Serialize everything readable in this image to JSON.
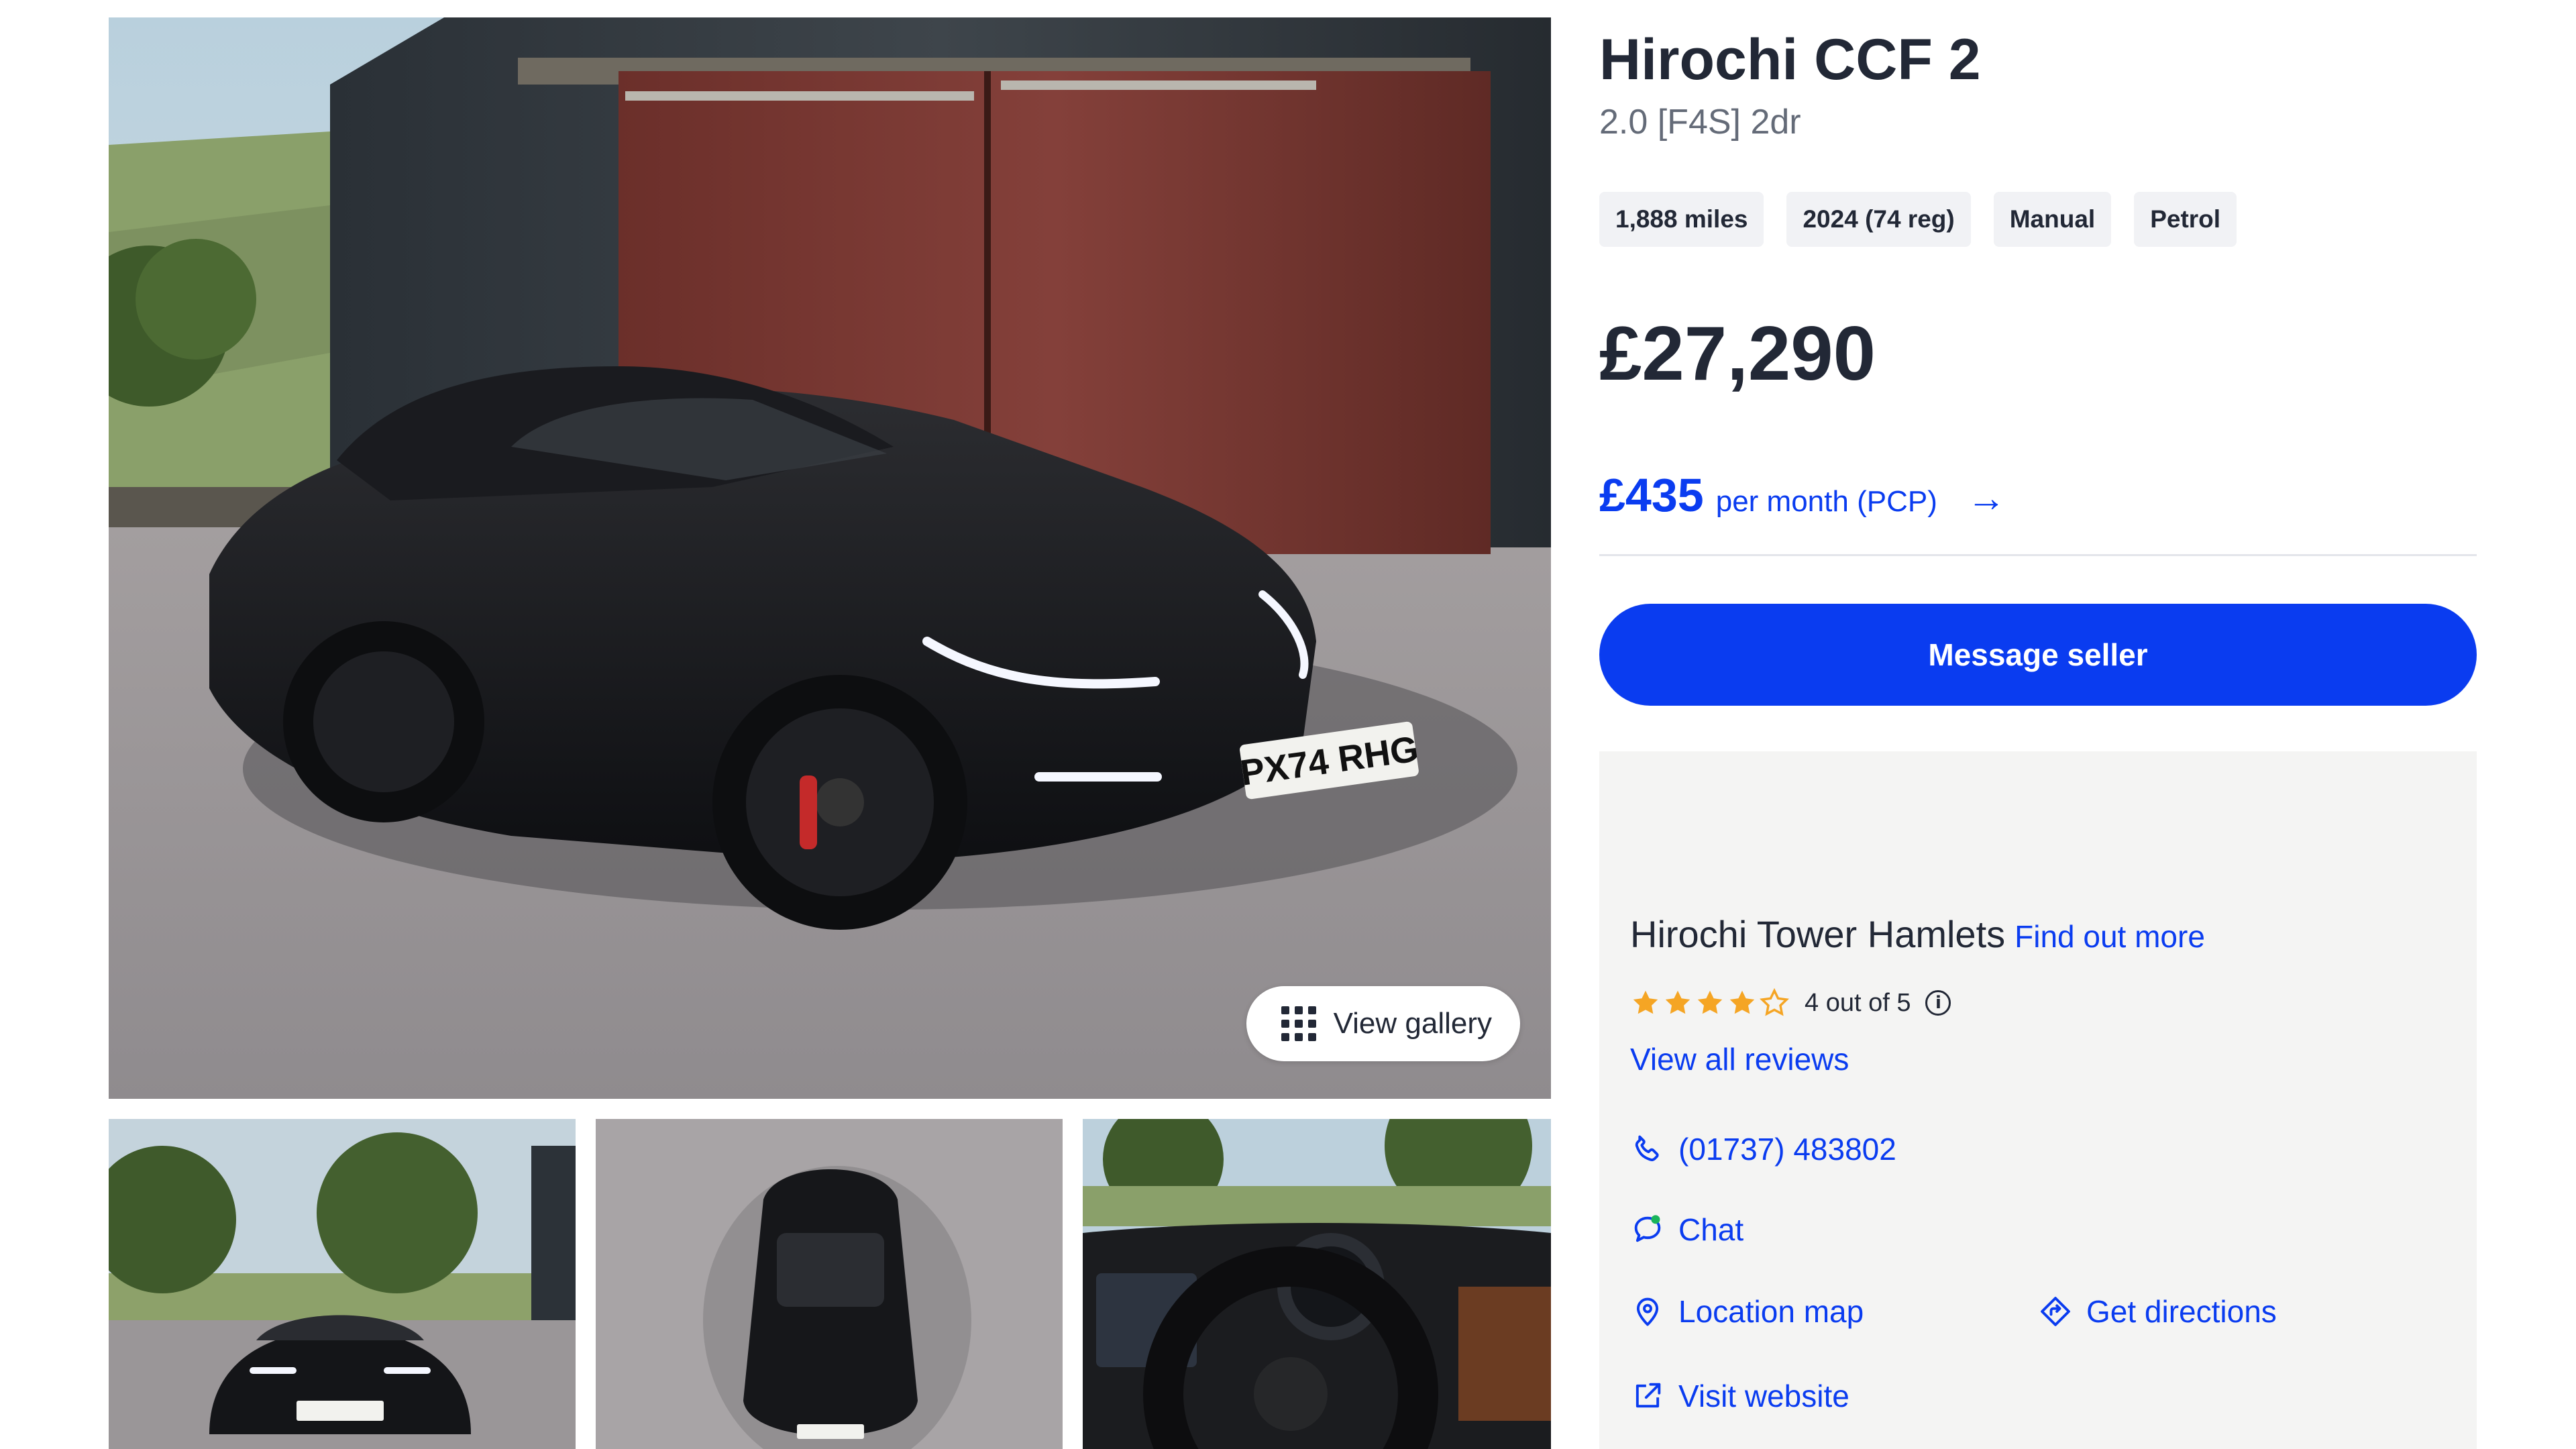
{
  "gallery": {
    "view_gallery_label": "View gallery",
    "plate": "PX74 RHG"
  },
  "listing": {
    "title": "Hirochi CCF 2",
    "subtitle": "2.0 [F4S] 2dr",
    "specs": [
      "1,888 miles",
      "2024 (74 reg)",
      "Manual",
      "Petrol"
    ],
    "price": "£27,290",
    "finance_amount": "£435",
    "finance_label": "per month (PCP)",
    "message_button": "Message seller"
  },
  "seller": {
    "name": "Hirochi Tower Hamlets",
    "find_out_more": "Find out more",
    "rating": 4,
    "rating_max": 5,
    "rating_text": "4 out of 5",
    "view_reviews": "View all reviews",
    "phone": "(01737) 483802",
    "chat": "Chat",
    "location_map": "Location map",
    "get_directions": "Get directions",
    "visit_website": "Visit website"
  },
  "colors": {
    "accent": "#0a3cf0",
    "text": "#222836",
    "muted": "#646b78",
    "star": "#f5a524",
    "panel": "#f4f4f3"
  },
  "icons": [
    "grid-icon",
    "arrow-right-icon",
    "star-icon",
    "info-icon",
    "phone-icon",
    "chat-icon",
    "location-pin-icon",
    "directions-icon",
    "external-link-icon"
  ]
}
